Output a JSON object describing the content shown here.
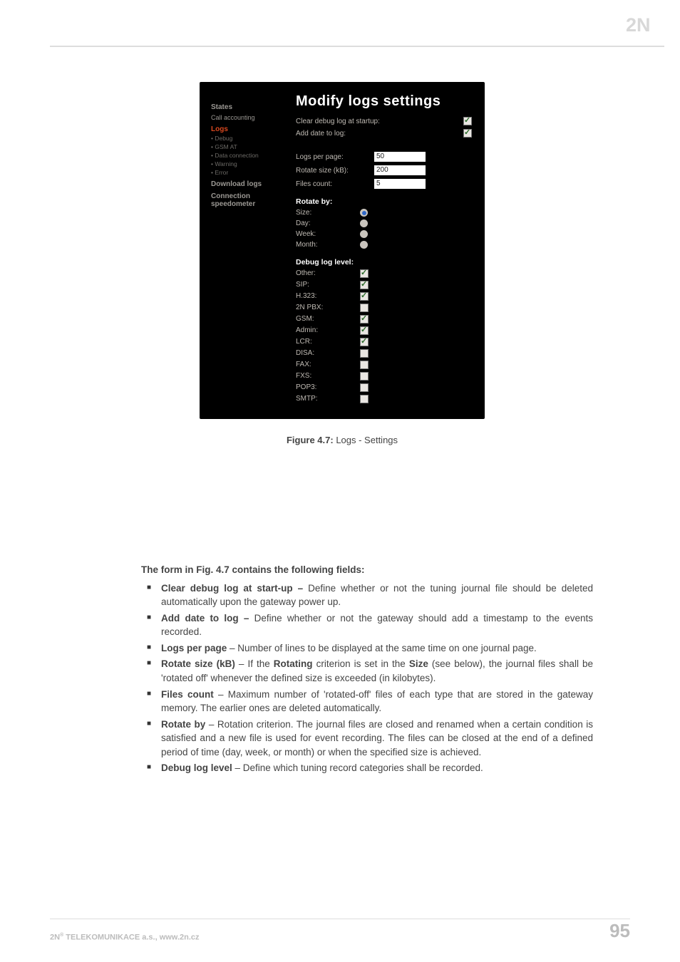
{
  "header": {
    "brand": "2N"
  },
  "shot": {
    "sidebar": {
      "states": "States",
      "call_accounting": "Call accounting",
      "logs": "Logs",
      "subs": [
        "• Debug",
        "• GSM AT",
        "• Data connection",
        "• Warning",
        "• Error"
      ],
      "download_logs": "Download logs",
      "conn_speedo_1": "Connection",
      "conn_speedo_2": "speedometer"
    },
    "title": "Modify logs settings",
    "rows": {
      "clear_label": "Clear debug log at startup:",
      "add_date_label": "Add date to log:",
      "logs_per_page_label": "Logs per page:",
      "logs_per_page_val": "50",
      "rotate_size_label": "Rotate size (kB):",
      "rotate_size_val": "200",
      "files_count_label": "Files count:",
      "files_count_val": "5"
    },
    "rotate_by_head": "Rotate by:",
    "rotate_by": [
      {
        "label": "Size:",
        "selected": true
      },
      {
        "label": "Day:",
        "selected": false
      },
      {
        "label": "Week:",
        "selected": false
      },
      {
        "label": "Month:",
        "selected": false
      }
    ],
    "debug_head": "Debug log level:",
    "debug_levels": [
      {
        "label": "Other:",
        "checked": true
      },
      {
        "label": "SIP:",
        "checked": true
      },
      {
        "label": "H.323:",
        "checked": true
      },
      {
        "label": "2N PBX:",
        "checked": false
      },
      {
        "label": "GSM:",
        "checked": true
      },
      {
        "label": "Admin:",
        "checked": true
      },
      {
        "label": "LCR:",
        "checked": true
      },
      {
        "label": "DISA:",
        "checked": false
      },
      {
        "label": "FAX:",
        "checked": false
      },
      {
        "label": "FXS:",
        "checked": false
      },
      {
        "label": "POP3:",
        "checked": false
      },
      {
        "label": "SMTP:",
        "checked": false
      }
    ]
  },
  "caption": {
    "bold": "Figure 4.7:",
    "rest": " Logs - Settings"
  },
  "body": {
    "lead": "The form in Fig. 4.7 contains the following fields:",
    "items": [
      {
        "bold": "Clear debug log at start-up – ",
        "rest": " Define whether or not the tuning journal file should be deleted automatically upon the gateway power up."
      },
      {
        "bold": "Add date to log – ",
        "rest": "Define whether or not the gateway should add a timestamp to the events recorded."
      },
      {
        "bold": "Logs per page",
        "rest": " – Number of lines to be displayed at the same time on one journal page."
      },
      {
        "bold": "Rotate size (kB)",
        "rest": " – If the ",
        "bold2": "Rotating",
        "rest2": " criterion is set in the ",
        "bold3": "Size",
        "rest3": " (see below), the journal files shall be 'rotated off' whenever the defined size is exceeded (in kilobytes)."
      },
      {
        "bold": "Files count",
        "rest": " – Maximum number of 'rotated-off' files of each type that are stored in the gateway memory. The earlier ones are deleted automatically."
      },
      {
        "bold": "Rotate by",
        "rest": " – Rotation criterion. The journal files are closed and renamed when a certain condition is satisfied and a new file is used for event recording. The files can be closed at the end of a defined period of time (day, week, or month) or when the specified size is achieved."
      },
      {
        "bold": "Debug log level",
        "rest": " – Define which tuning record categories shall be recorded."
      }
    ]
  },
  "footer": {
    "left_pre": "2N",
    "left_sup": "®",
    "left_post": " TELEKOMUNIKACE a.s., www.2n.cz",
    "page": "95"
  }
}
